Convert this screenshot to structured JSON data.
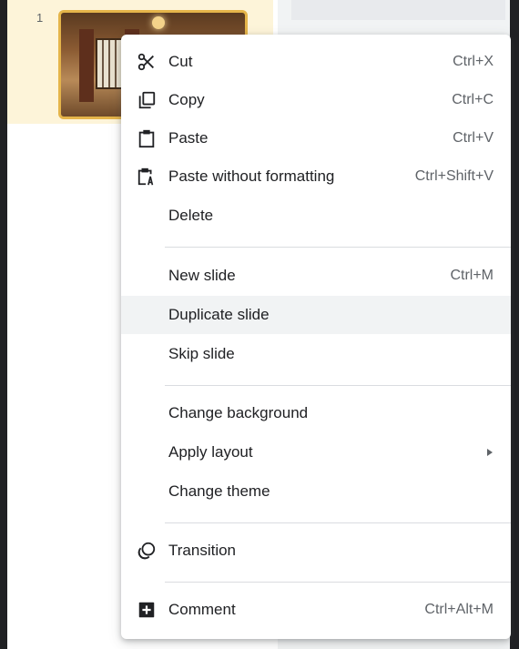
{
  "filmstrip": {
    "slide_number": "1"
  },
  "menu": {
    "cut": {
      "label": "Cut",
      "shortcut": "Ctrl+X",
      "icon": "scissors-icon"
    },
    "copy": {
      "label": "Copy",
      "shortcut": "Ctrl+C",
      "icon": "copy-icon"
    },
    "paste": {
      "label": "Paste",
      "shortcut": "Ctrl+V",
      "icon": "clipboard-icon"
    },
    "paste_plain": {
      "label": "Paste without formatting",
      "shortcut": "Ctrl+Shift+V",
      "icon": "clipboard-text-icon"
    },
    "delete": {
      "label": "Delete"
    },
    "new_slide": {
      "label": "New slide",
      "shortcut": "Ctrl+M"
    },
    "duplicate_slide": {
      "label": "Duplicate slide",
      "highlighted": true
    },
    "skip_slide": {
      "label": "Skip slide"
    },
    "change_background": {
      "label": "Change background"
    },
    "apply_layout": {
      "label": "Apply layout",
      "has_submenu": true
    },
    "change_theme": {
      "label": "Change theme"
    },
    "transition": {
      "label": "Transition",
      "icon": "transition-icon"
    },
    "comment": {
      "label": "Comment",
      "shortcut": "Ctrl+Alt+M",
      "icon": "add-comment-icon"
    }
  },
  "colors": {
    "selected_slide_bg": "#fdf4d9",
    "thumb_border": "#e5b54a",
    "highlight_bg": "#f1f3f4",
    "text": "#202124",
    "shortcut_text": "#5f6368"
  }
}
